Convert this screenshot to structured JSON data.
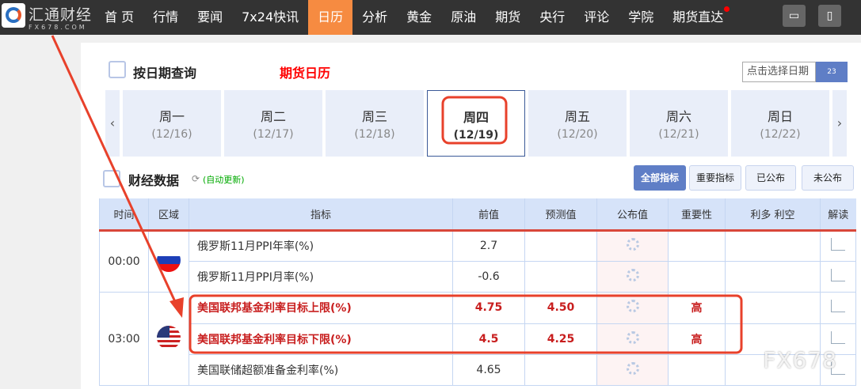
{
  "brand": {
    "name": "汇通财经",
    "domain": "FX678.COM"
  },
  "nav": [
    "首 页",
    "行情",
    "要闻",
    "7x24快讯",
    "日历",
    "分析",
    "黄金",
    "原油",
    "期货",
    "央行",
    "评论",
    "学院",
    "期货直达"
  ],
  "nav_active": 4,
  "query": {
    "title": "按日期查询",
    "subtitle": "期货日历",
    "date_placeholder": "点击选择日期",
    "cal_day": "23"
  },
  "days": [
    {
      "d": "周一",
      "n": "(12/16)"
    },
    {
      "d": "周二",
      "n": "(12/17)"
    },
    {
      "d": "周三",
      "n": "(12/18)"
    },
    {
      "d": "周四",
      "n": "(12/19)"
    },
    {
      "d": "周五",
      "n": "(12/20)"
    },
    {
      "d": "周六",
      "n": "(12/21)"
    },
    {
      "d": "周日",
      "n": "(12/22)"
    }
  ],
  "selected_day": 3,
  "data_section": {
    "title": "财经数据",
    "auto": "(自动更新)"
  },
  "filters": [
    "全部指标",
    "重要指标",
    "已公布",
    "未公布"
  ],
  "headers": [
    "时间",
    "区域",
    "指标",
    "前值",
    "预测值",
    "公布值",
    "重要性",
    "利多 利空",
    "解读"
  ],
  "rows": [
    {
      "time": "00:00",
      "flag": "ru",
      "span": 2,
      "name": "俄罗斯11月PPI年率(%)",
      "prev": "2.7",
      "fc": "",
      "imp": "",
      "hl": false
    },
    {
      "name": "俄罗斯11月PPI月率(%)",
      "prev": "-0.6",
      "fc": "",
      "imp": "",
      "hl": false
    },
    {
      "time": "03:00",
      "flag": "us",
      "span": 3,
      "name": "美国联邦基金利率目标上限(%)",
      "prev": "4.75",
      "fc": "4.50",
      "imp": "高",
      "hl": true
    },
    {
      "name": "美国联邦基金利率目标下限(%)",
      "prev": "4.5",
      "fc": "4.25",
      "imp": "高",
      "hl": true
    },
    {
      "name": "美国联储超额准备金利率(%)",
      "prev": "4.65",
      "fc": "",
      "imp": "",
      "hl": false
    }
  ],
  "watermark": "FX678"
}
